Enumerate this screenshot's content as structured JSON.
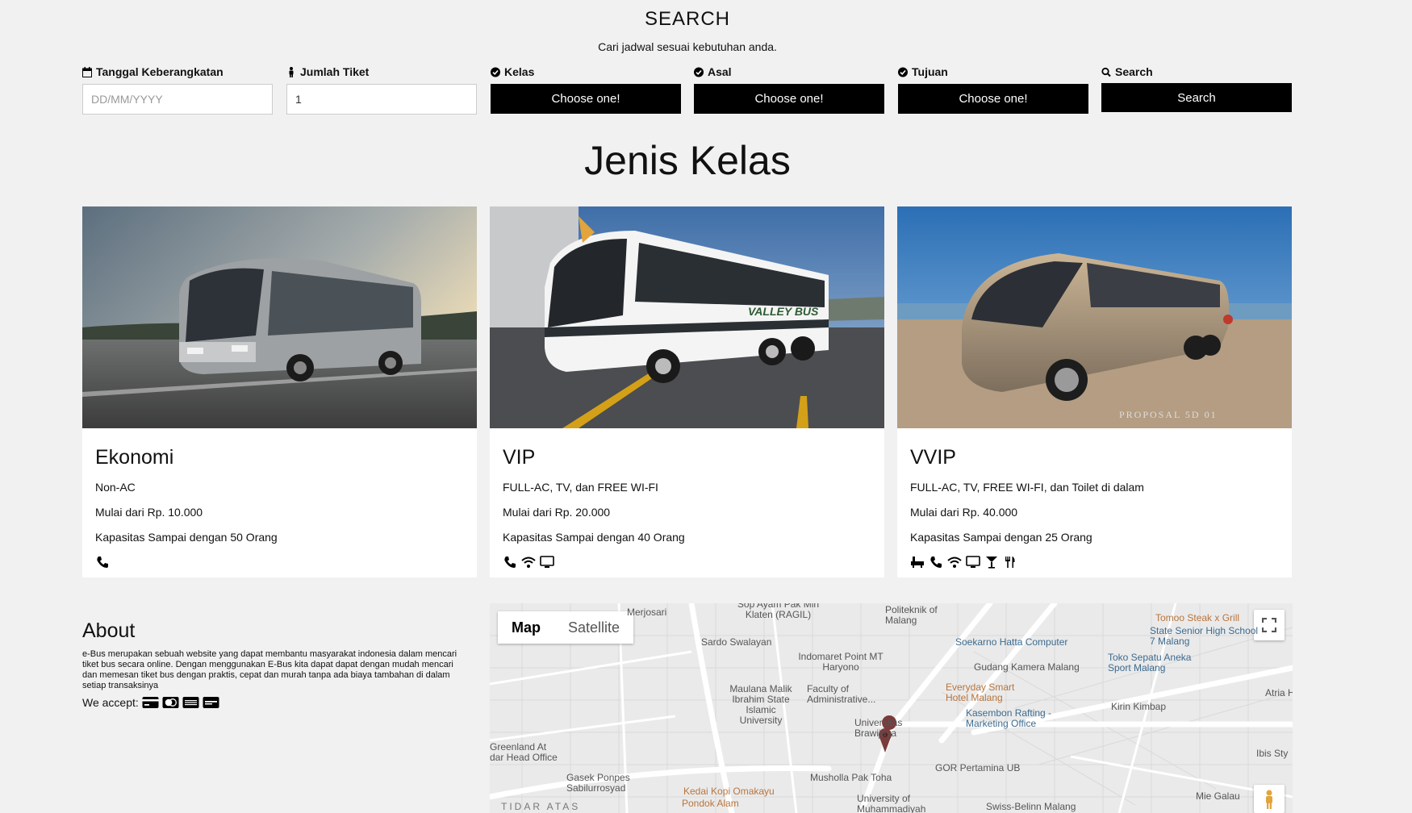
{
  "search": {
    "title": "SEARCH",
    "subtitle": "Cari jadwal sesuai kebutuhan anda.",
    "fields": [
      {
        "label": "Tanggal Keberangkatan",
        "icon": "calendar-icon",
        "type": "input",
        "placeholder": "DD/MM/YYYY",
        "value": ""
      },
      {
        "label": "Jumlah Tiket",
        "icon": "person-icon",
        "type": "input",
        "placeholder": "",
        "value": "1"
      },
      {
        "label": "Kelas",
        "icon": "check-circle-icon",
        "type": "select",
        "value": "Choose one!"
      },
      {
        "label": "Asal",
        "icon": "check-circle-icon",
        "type": "select",
        "value": "Choose one!"
      },
      {
        "label": "Tujuan",
        "icon": "check-circle-icon",
        "type": "select",
        "value": "Choose one!"
      },
      {
        "label": "Search",
        "icon": "search-icon",
        "type": "button",
        "value": "Search"
      }
    ]
  },
  "classes": {
    "title": "Jenis Kelas",
    "cards": [
      {
        "name": "Ekonomi",
        "facility": "Non-AC",
        "price": "Mulai dari Rp. 10.000",
        "capacity": "Kapasitas Sampai dengan 50 Orang",
        "icons": [
          "phone-icon"
        ]
      },
      {
        "name": "VIP",
        "facility": "FULL-AC, TV, dan FREE WI-FI",
        "price": "Mulai dari Rp. 20.000",
        "capacity": "Kapasitas Sampai dengan 40 Orang",
        "icons": [
          "phone-icon",
          "wifi-icon",
          "tv-icon"
        ]
      },
      {
        "name": "VVIP",
        "facility": "FULL-AC, TV, FREE WI-FI, dan Toilet di dalam",
        "price": "Mulai dari Rp. 40.000",
        "capacity": "Kapasitas Sampai dengan 25 Orang",
        "icons": [
          "bath-icon",
          "phone-icon",
          "wifi-icon",
          "tv-icon",
          "cocktail-icon",
          "cutlery-icon"
        ]
      }
    ],
    "photo3_watermark": "PROPOSAL 5D 01",
    "photo2_bus_text": "VALLEY BUS"
  },
  "about": {
    "title": "About",
    "text": "e-Bus merupakan sebuah website yang dapat membantu masyarakat indonesia dalam mencari tiket bus secara online. Dengan menggunakan E-Bus kita dapat dapat dengan mudah mencari dan memesan tiket bus dengan praktis, cepat dan murah tanpa ada biaya tambahan di dalam setiap transaksinya",
    "accept_label": "We accept:",
    "payment_icons": [
      "credit-card-icon",
      "mastercard-icon",
      "amex-icon",
      "paypal-icon"
    ]
  },
  "map": {
    "tabs": [
      "Map",
      "Satellite"
    ],
    "active_tab": "Map",
    "labels": [
      "Tomoo Steak x Grill",
      "State Senior High School 7 Malang",
      "Politeknik of Malang",
      "Sardo Swalayan",
      "Soekarno Hatta Computer",
      "Indomaret Point MT Haryono",
      "Gudang Kamera Malang",
      "Toko Sepatu Aneka Sport Malang",
      "Maulana Malik Ibrahim State Islamic University",
      "Faculty of Administrative...",
      "Everyday Smart Hotel Malang",
      "Atria Ho",
      "Kirin Kimbap",
      "Kasembon Rafting - Marketing Office",
      "Universitas Brawijaya",
      "Ibis Sty",
      "Greenland At dar Head Office",
      "GOR Pertamina UB",
      "Gasek Ponpes Sabilurrosyad",
      "Musholla Pak Toha",
      "Kedai Kopi Omakayu",
      "Pondok Alam",
      "University of Muhammadiyah",
      "Swiss-Belinn Malang",
      "Mie Galau",
      "TIDAR ATAS",
      "Sop Ayam Pak Min Klaten (RAGIL)",
      "Merjosari"
    ]
  }
}
